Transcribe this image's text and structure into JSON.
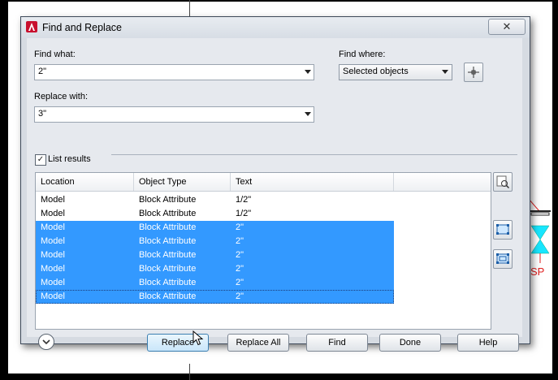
{
  "window": {
    "title": "Find and Replace",
    "close_symbol": "✕"
  },
  "find_what": {
    "label": "Find what:",
    "value": "2\""
  },
  "replace_with": {
    "label": "Replace with:",
    "value": "3\""
  },
  "find_where": {
    "label": "Find where:",
    "value": "Selected objects"
  },
  "list_results": {
    "label": "List results",
    "checked": true
  },
  "table": {
    "headers": [
      "Location",
      "Object Type",
      "Text"
    ],
    "rows": [
      {
        "location": "Model",
        "object_type": "Block Attribute",
        "text": "1/2\"",
        "selected": false
      },
      {
        "location": "Model",
        "object_type": "Block Attribute",
        "text": "1/2\"",
        "selected": false
      },
      {
        "location": "Model",
        "object_type": "Block Attribute",
        "text": "2\"",
        "selected": true
      },
      {
        "location": "Model",
        "object_type": "Block Attribute",
        "text": "2\"",
        "selected": true
      },
      {
        "location": "Model",
        "object_type": "Block Attribute",
        "text": "2\"",
        "selected": true
      },
      {
        "location": "Model",
        "object_type": "Block Attribute",
        "text": "2\"",
        "selected": true
      },
      {
        "location": "Model",
        "object_type": "Block Attribute",
        "text": "2\"",
        "selected": true
      },
      {
        "location": "Model",
        "object_type": "Block Attribute",
        "text": "2\"",
        "selected": true
      }
    ]
  },
  "buttons": {
    "replace": "Replace",
    "replace_all": "Replace All",
    "find": "Find",
    "done": "Done",
    "help": "Help"
  },
  "background_label": "SP",
  "colors": {
    "selection": "#3399ff",
    "accent_red": "#e02020",
    "cyan_valve": "#19e6ff"
  }
}
